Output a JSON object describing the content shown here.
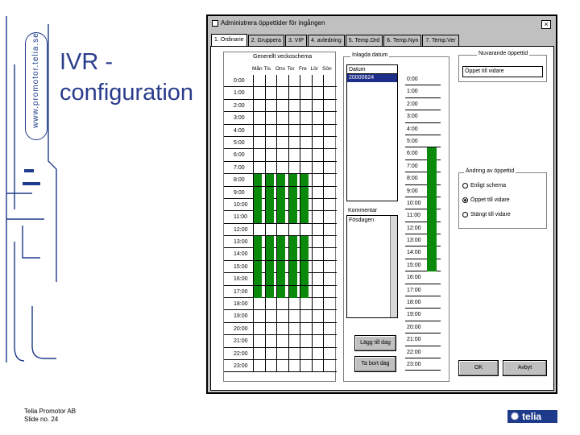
{
  "slide": {
    "title_line1": "IVR -",
    "title_line2": "configuration",
    "vertical_url": "www.promotor.telia.se",
    "footer_company": "Telia Promotor AB",
    "footer_slide": "Slide no. 24",
    "logo_text": "telia",
    "accent_color": "#2a3c8c"
  },
  "window": {
    "title": "Administrera öppettider för ingången",
    "close_label": "×",
    "tabs": [
      "1. Ordinarie",
      "2. Gruppera",
      "3. VIP",
      "4. avledning",
      "5. Temp.Ord",
      "6. Temp.Nyn",
      "7. Temp.Ver"
    ],
    "active_tab": 0
  },
  "weekly": {
    "group_label": "Generellt veckoschema",
    "days": [
      "Mån",
      "Tis",
      "Ons",
      "Tor",
      "Fre",
      "Lör",
      "Sön"
    ],
    "hours": [
      "0:00",
      "1:00",
      "2:00",
      "3:00",
      "4:00",
      "5:00",
      "6:00",
      "7:00",
      "8:00",
      "9:00",
      "10:00",
      "11:00",
      "12:00",
      "13:00",
      "14:00",
      "15:00",
      "16:00",
      "17:00",
      "18:00",
      "19:00",
      "20:00",
      "21:00",
      "22:00",
      "23:00"
    ],
    "open_rows": [
      8,
      9,
      10,
      11,
      13,
      14,
      15,
      16,
      17
    ],
    "open_days": [
      0,
      1,
      2,
      3,
      4
    ],
    "open_color": "#0a8a0a"
  },
  "dates": {
    "group_label": "Inlagda datum",
    "list_header": "Datum",
    "selected_date": "20000624",
    "comment_label": "Kommentar",
    "comment_text": "Fösdagen",
    "hours": [
      "0:00",
      "1:00",
      "2:00",
      "3:00",
      "4:00",
      "5:00",
      "6:00",
      "7:00",
      "8:00",
      "9:00",
      "10:00",
      "11:00",
      "12:00",
      "13:00",
      "14:00",
      "15:00",
      "16:00",
      "17:00",
      "18:00",
      "19:00",
      "20:00",
      "21:00",
      "22:00",
      "23:00"
    ],
    "open_rows": [
      6,
      7,
      8,
      9,
      10,
      11,
      12,
      13,
      14,
      15
    ],
    "add_button": "Lägg till dag",
    "remove_button": "Ta bort dag"
  },
  "current": {
    "group_label": "Nuvarande öppettid",
    "value": "Öppet till vidare"
  },
  "change": {
    "group_label": "Ändring av öppettid",
    "options": [
      "Enligt schema",
      "Öppet till vidare",
      "Stängt till vidare"
    ],
    "selected": 1
  },
  "buttons": {
    "ok": "OK",
    "cancel": "Avbyt"
  }
}
